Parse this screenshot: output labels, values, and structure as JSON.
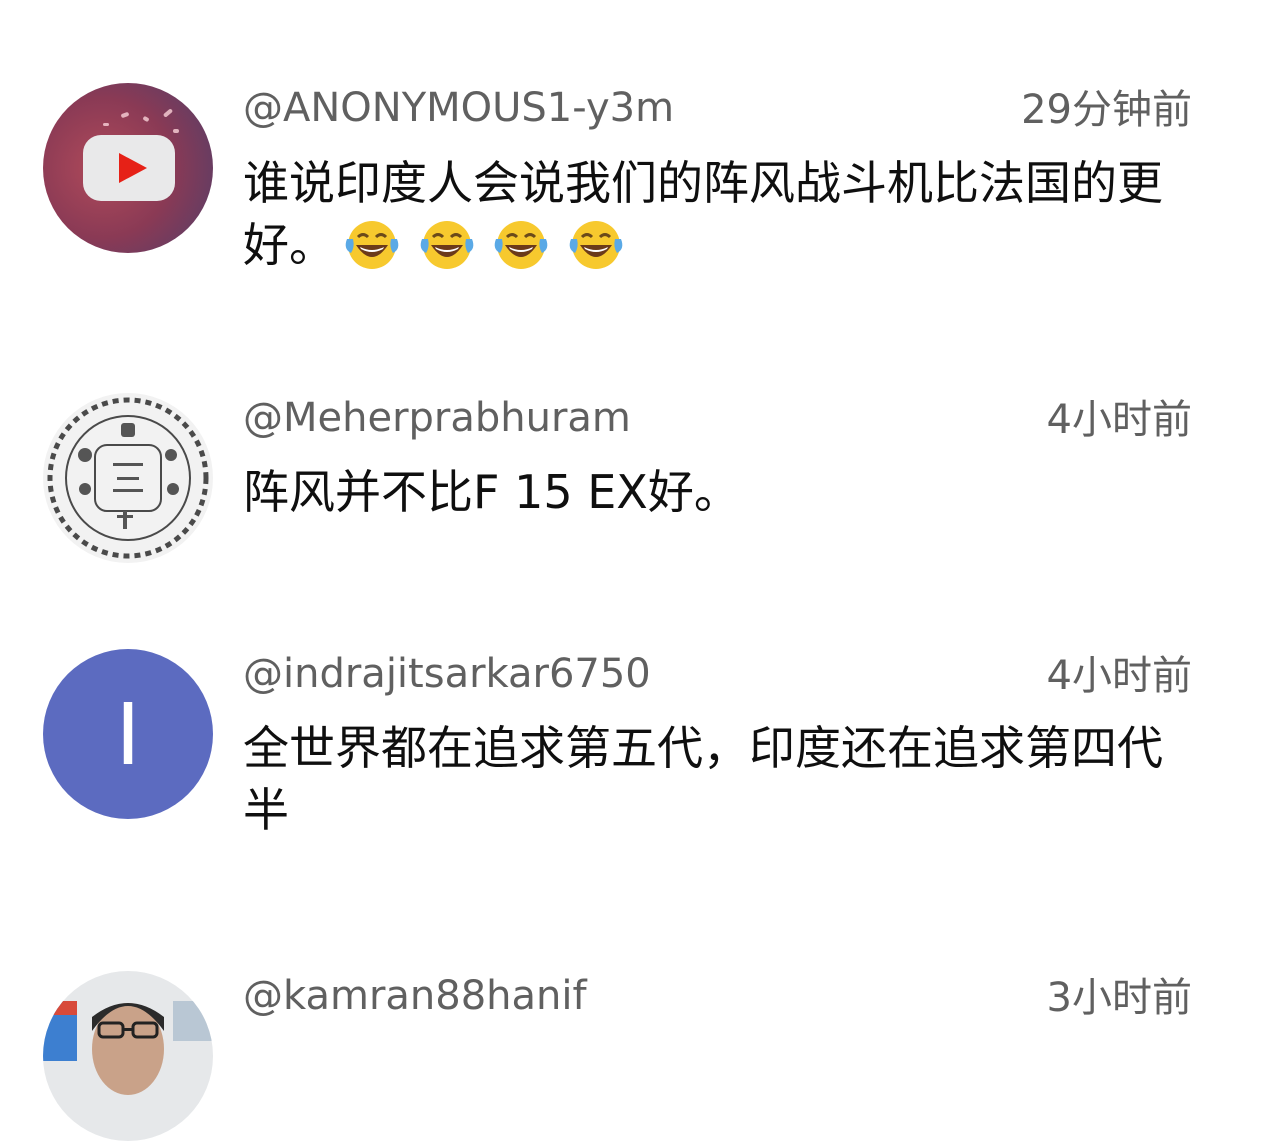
{
  "comments": [
    {
      "username": "@ANONYMOUS1-y3m",
      "time": "29分钟前",
      "text": "谁说印度人会说我们的阵风战斗机比法国的更好。",
      "emoji": "face-with-tears-of-joy",
      "emoji_count": 4,
      "avatar": "youtube-logo-icon"
    },
    {
      "username": "@Meherprabhuram",
      "time": "4小时前",
      "text": "阵风并不比F 15 EX好。",
      "avatar": "religious-symbols-emblem-icon"
    },
    {
      "username": "@indrajitsarkar6750",
      "time": "4小时前",
      "text": "全世界都在追求第五代，印度还在追求第四代半",
      "avatar_letter": "I",
      "avatar_color": "#5c6bc0"
    },
    {
      "username": "@kamran88hanif",
      "time": "3小时前",
      "text": "",
      "avatar": "person-photo"
    }
  ],
  "colors": {
    "meta_text": "#606060",
    "body_text": "#0f0f0f",
    "youtube_red": "#e62117"
  }
}
